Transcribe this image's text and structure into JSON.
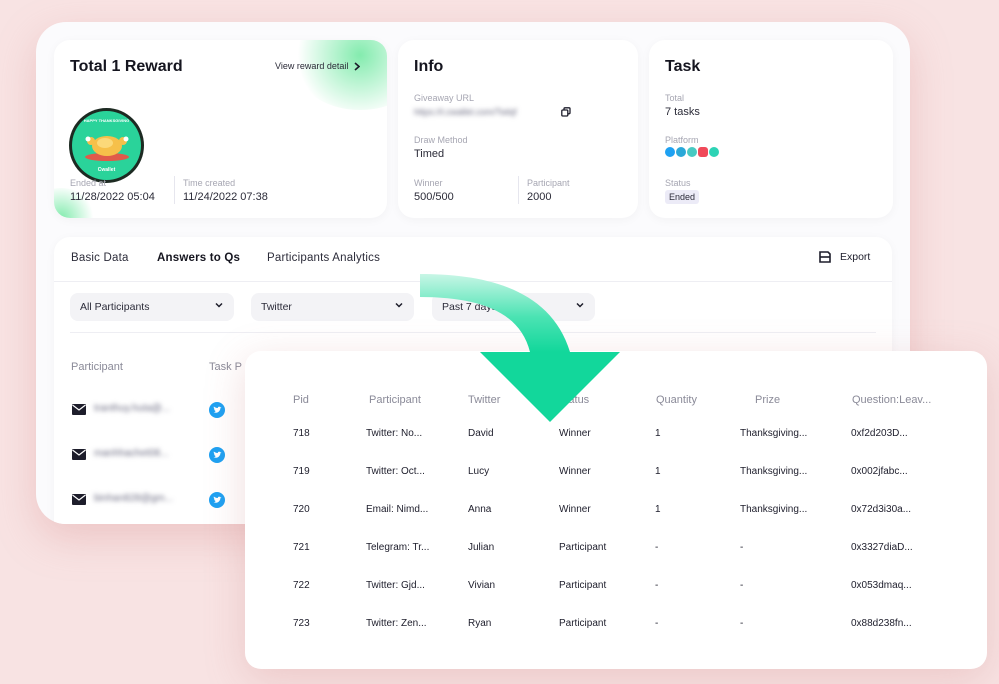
{
  "reward_card": {
    "title": "Total 1 Reward",
    "view_detail_label": "View reward detail",
    "badge_top_text": "HAPPY THANKSGIVING",
    "badge_brand": "Cwallet",
    "ended_label": "Ended at",
    "ended_value": "11/28/2022 05:04",
    "created_label": "Time created",
    "created_value": "11/24/2022 07:38"
  },
  "info_card": {
    "title": "Info",
    "url_label": "Giveaway URL",
    "url_value": "https://t.cwallet.com/Twlqf",
    "draw_label": "Draw Method",
    "draw_value": "Timed",
    "winner_label": "Winner",
    "winner_value": "500/500",
    "participant_label": "Participant",
    "participant_value": "2000"
  },
  "task_card": {
    "title": "Task",
    "total_label": "Total",
    "total_value": "7 tasks",
    "platform_label": "Platform",
    "platforms": [
      "twitter",
      "telegram",
      "discord",
      "youtube",
      "email"
    ],
    "status_label": "Status",
    "status_value": "Ended"
  },
  "tabs": [
    "Basic Data",
    "Answers to Qs",
    "Participants Analytics"
  ],
  "export_label": "Export",
  "filters": [
    "All Participants",
    "Twitter",
    "Past 7 days"
  ],
  "participants_table": {
    "headers": [
      "Participant",
      "Task P"
    ],
    "rows": [
      "tranthuy.huta@...",
      "manhhachet08...",
      "binhan828@gm..."
    ]
  },
  "overlay_table": {
    "headers": [
      "Pid",
      "Participant",
      "Twitter",
      "Status",
      "Quantity",
      "Prize",
      "Question:Leav..."
    ],
    "rows": [
      [
        "718",
        "Twitter: No...",
        "David",
        "Winner",
        "1",
        "Thanksgiving...",
        "0xf2d203D..."
      ],
      [
        "719",
        "Twitter: Oct...",
        "Lucy",
        "Winner",
        "1",
        "Thanksgiving...",
        "0x002jfabc..."
      ],
      [
        "720",
        "Email: Nimd...",
        "Anna",
        "Winner",
        "1",
        "Thanksgiving...",
        "0x72d3i30a..."
      ],
      [
        "721",
        "Telegram: Tr...",
        "Julian",
        "Participant",
        "-",
        "-",
        "0x3327diaD..."
      ],
      [
        "722",
        "Twitter: Gjd...",
        "Vivian",
        "Participant",
        "-",
        "-",
        "0x053dmaq..."
      ],
      [
        "723",
        "Twitter: Zen...",
        "Ryan",
        "Participant",
        "-",
        "-",
        "0x88d238fn..."
      ]
    ]
  },
  "colors": {
    "background": "#f8e3e3",
    "accent_green": "#1fd9a0",
    "twitter_blue": "#1ea1f2",
    "status_badge_bg": "#ecebf7"
  }
}
